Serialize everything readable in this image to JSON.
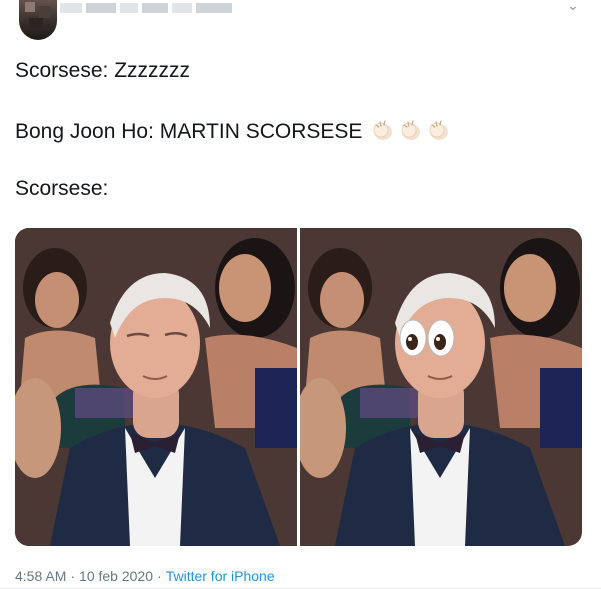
{
  "tweet": {
    "lines": [
      "Scorsese: Zzzzzzz",
      "Bong Joon Ho: MARTIN SCORSESE",
      "Scorsese:"
    ],
    "emoji": [
      "clapping-hands",
      "clapping-hands",
      "clapping-hands"
    ],
    "media": {
      "left_photo": "man-eyes-closed",
      "right_photo": "man-with-googly-eyes-emoji"
    },
    "footer": {
      "time": "4:58 AM",
      "date": "10 feb 2020",
      "separator": "·",
      "source": "Twitter for iPhone"
    }
  },
  "colors": {
    "text": "#14171a",
    "muted": "#657786",
    "link": "#1b95e0",
    "suit": "#1f2a44"
  }
}
